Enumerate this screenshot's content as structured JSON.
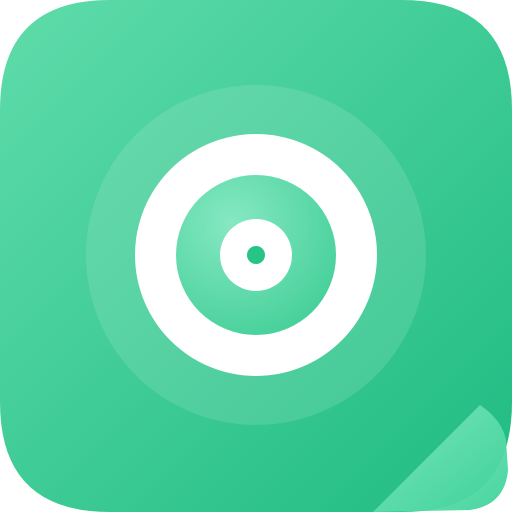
{
  "icon": {
    "name": "target-icon",
    "colors": {
      "tile_light": "#5fdcaa",
      "tile_dark": "#1fbb82",
      "halo": "#ffffff",
      "ring": "#ffffff",
      "center_dot": "#26c488",
      "fold_light": "#7fe6bf",
      "fold_dark": "#3fd39a"
    }
  }
}
